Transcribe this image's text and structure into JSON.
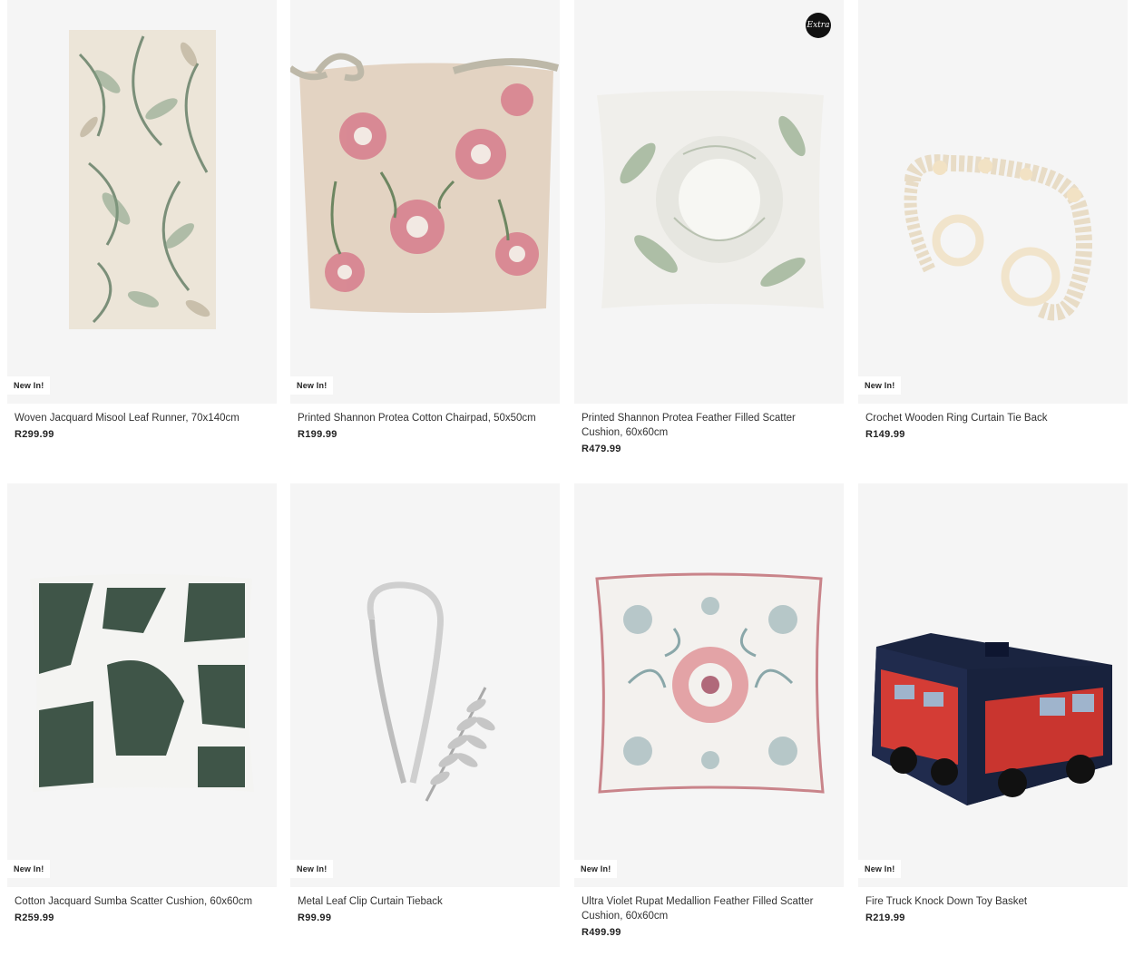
{
  "products": [
    {
      "title": "Woven Jacquard Misool Leaf Runner, 70x140cm",
      "price": "R299.99",
      "badge": "New In!",
      "image": "leaf-runner-image"
    },
    {
      "title": "Printed Shannon Protea Cotton Chairpad, 50x50cm",
      "price": "R199.99",
      "badge": "New In!",
      "image": "protea-chairpad-image"
    },
    {
      "title": "Printed Shannon Protea Feather Filled Scatter Cushion, 60x60cm",
      "price": "R479.99",
      "badge": "",
      "corner_badge": "Extra",
      "image": "protea-cushion-image"
    },
    {
      "title": "Crochet Wooden Ring Curtain Tie Back",
      "price": "R149.99",
      "badge": "New In!",
      "image": "crochet-tieback-image"
    },
    {
      "title": "Cotton Jacquard Sumba Scatter Cushion, 60x60cm",
      "price": "R259.99",
      "badge": "New In!",
      "image": "sumba-cushion-image"
    },
    {
      "title": "Metal Leaf Clip Curtain Tieback",
      "price": "R99.99",
      "badge": "New In!",
      "image": "metal-tieback-image"
    },
    {
      "title": "Ultra Violet Rupat Medallion Feather Filled Scatter Cushion, 60x60cm",
      "price": "R499.99",
      "badge": "New In!",
      "image": "medallion-cushion-image"
    },
    {
      "title": "Fire Truck Knock Down Toy Basket",
      "price": "R219.99",
      "badge": "New In!",
      "image": "fire-truck-basket-image"
    }
  ]
}
